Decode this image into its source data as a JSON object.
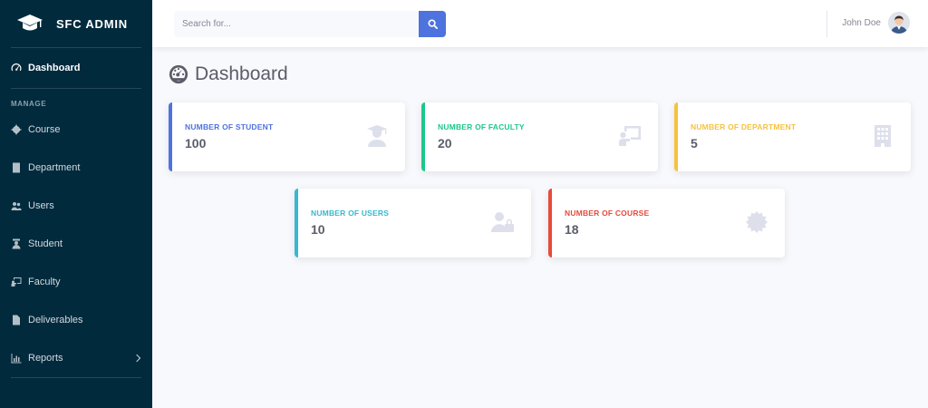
{
  "brand": {
    "name": "SFC ADMIN",
    "icon": "graduation-cap-icon"
  },
  "sidebar": {
    "dashboard": {
      "label": "Dashboard",
      "icon": "tachometer-icon"
    },
    "section_heading": "MANAGE",
    "items": [
      {
        "label": "Course",
        "icon": "gear-badge-icon"
      },
      {
        "label": "Department",
        "icon": "building-icon"
      },
      {
        "label": "Users",
        "icon": "users-icon"
      },
      {
        "label": "Student",
        "icon": "student-icon"
      },
      {
        "label": "Faculty",
        "icon": "chalkboard-teacher-icon"
      },
      {
        "label": "Deliverables",
        "icon": "file-icon"
      },
      {
        "label": "Reports",
        "icon": "chart-icon"
      }
    ]
  },
  "topbar": {
    "search": {
      "placeholder": "Search for...",
      "value": ""
    },
    "user_name": "John Doe"
  },
  "page": {
    "title": "Dashboard"
  },
  "cards": {
    "student": {
      "label": "NUMBER OF STUDENT",
      "value": "100",
      "color": "#4e73df"
    },
    "faculty": {
      "label": "NUMBER OF FACULTY",
      "value": "20",
      "color": "#1cc88a"
    },
    "department": {
      "label": "NUMBER OF DEPARTMENT",
      "value": "5",
      "color": "#f6c23e"
    },
    "users": {
      "label": "NUMBER OF USERS",
      "value": "10",
      "color": "#36b9cc"
    },
    "course": {
      "label": "NUMBER OF COURSE",
      "value": "18",
      "color": "#e74a3b"
    }
  },
  "colors": {
    "sidebar_bg": "#012a3d",
    "accent": "#4e73df",
    "page_bg": "#f8f9fc"
  }
}
